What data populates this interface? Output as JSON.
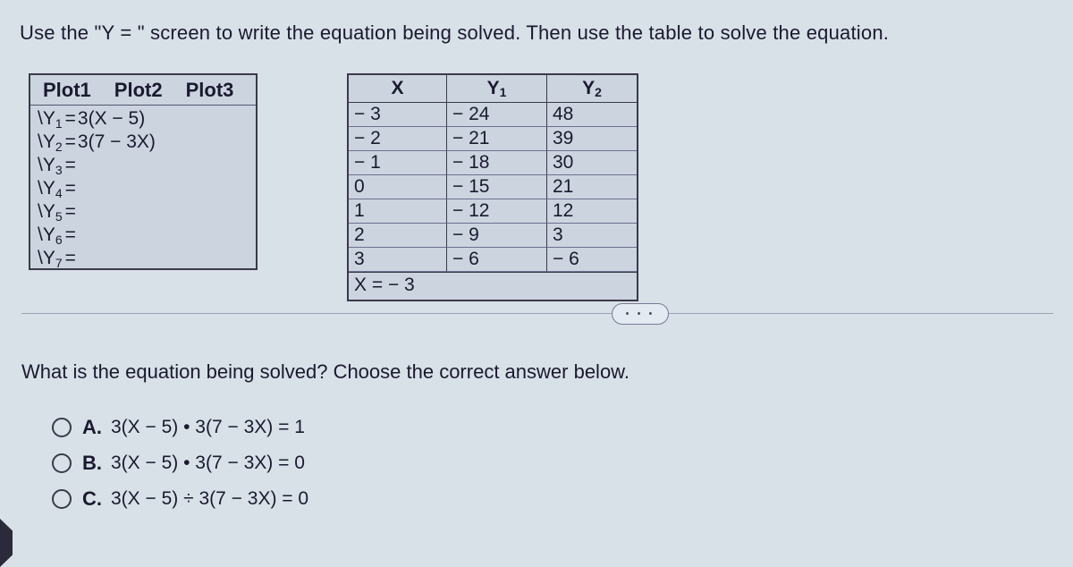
{
  "instruction": "Use the \"Y = \" screen to write the equation being solved. Then use the table to solve the equation.",
  "calc": {
    "plots": [
      "Plot1",
      "Plot2",
      "Plot3"
    ],
    "lines": [
      {
        "y": "Y",
        "sub": "1",
        "rhs": "3(X − 5)"
      },
      {
        "y": "Y",
        "sub": "2",
        "rhs": "3(7 − 3X)"
      },
      {
        "y": "Y",
        "sub": "3",
        "rhs": ""
      },
      {
        "y": "Y",
        "sub": "4",
        "rhs": ""
      },
      {
        "y": "Y",
        "sub": "5",
        "rhs": ""
      },
      {
        "y": "Y",
        "sub": "6",
        "rhs": ""
      },
      {
        "y": "Y",
        "sub": "7",
        "rhs": ""
      }
    ]
  },
  "table": {
    "headers": {
      "x": "X",
      "y1": "Y",
      "y1sub": "1",
      "y2": "Y",
      "y2sub": "2"
    },
    "rows": [
      {
        "x": "− 3",
        "y1": "− 24",
        "y2": "48"
      },
      {
        "x": "− 2",
        "y1": "− 21",
        "y2": "39"
      },
      {
        "x": "− 1",
        "y1": "− 18",
        "y2": "30"
      },
      {
        "x": "0",
        "y1": "− 15",
        "y2": "21"
      },
      {
        "x": "1",
        "y1": "− 12",
        "y2": "12"
      },
      {
        "x": "2",
        "y1": "− 9",
        "y2": "3"
      },
      {
        "x": "3",
        "y1": "− 6",
        "y2": "− 6"
      }
    ],
    "footer": "X = − 3"
  },
  "ellipsis": "• • •",
  "question": "What is the equation being solved? Choose the correct answer below.",
  "choices": {
    "a": {
      "label": "A.",
      "text": "3(X − 5) • 3(7 − 3X) = 1"
    },
    "b": {
      "label": "B.",
      "text": "3(X − 5) • 3(7 − 3X) = 0"
    },
    "c": {
      "label": "C.",
      "text": "3(X − 5) ÷ 3(7 − 3X) = 0"
    }
  }
}
